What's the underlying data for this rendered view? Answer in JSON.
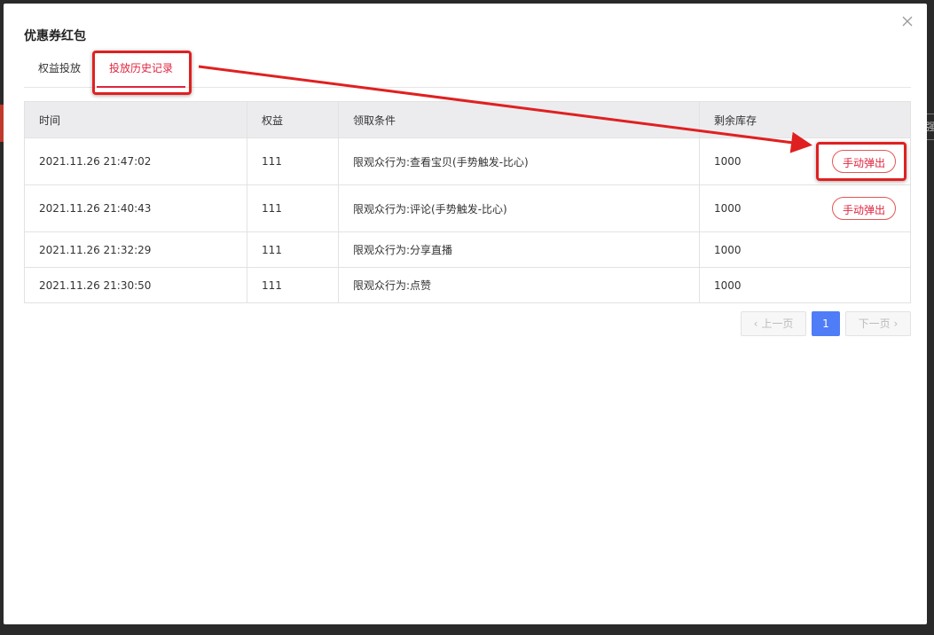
{
  "modal": {
    "title": "优惠券红包",
    "tabs": [
      {
        "label": "权益投放"
      },
      {
        "label": "投放历史记录"
      }
    ],
    "active_tab": "投放历史记录"
  },
  "table": {
    "headers": [
      "时间",
      "权益",
      "领取条件",
      "剩余库存"
    ],
    "rows": [
      {
        "time": "2021.11.26 21:47:02",
        "equity": "111",
        "condition": "限观众行为:查看宝贝(手势触发-比心)",
        "stock": "1000",
        "action": "手动弹出"
      },
      {
        "time": "2021.11.26 21:40:43",
        "equity": "111",
        "condition": "限观众行为:评论(手势触发-比心)",
        "stock": "1000",
        "action": "手动弹出"
      },
      {
        "time": "2021.11.26 21:32:29",
        "equity": "111",
        "condition": "限观众行为:分享直播",
        "stock": "1000"
      },
      {
        "time": "2021.11.26 21:30:50",
        "equity": "111",
        "condition": "限观众行为:点赞",
        "stock": "1000"
      }
    ]
  },
  "pagination": {
    "prev_label": "上一页",
    "current_page": "1",
    "next_label": "下一页"
  },
  "icons": {
    "close": "close-icon",
    "prev": "chevron-left-icon",
    "next": "chevron-right-icon"
  },
  "colors": {
    "accent": "#e0243f",
    "page_active": "#4f7cf7",
    "annotation": "#e02020"
  },
  "backdrop": {
    "right_chip_text": "强"
  }
}
